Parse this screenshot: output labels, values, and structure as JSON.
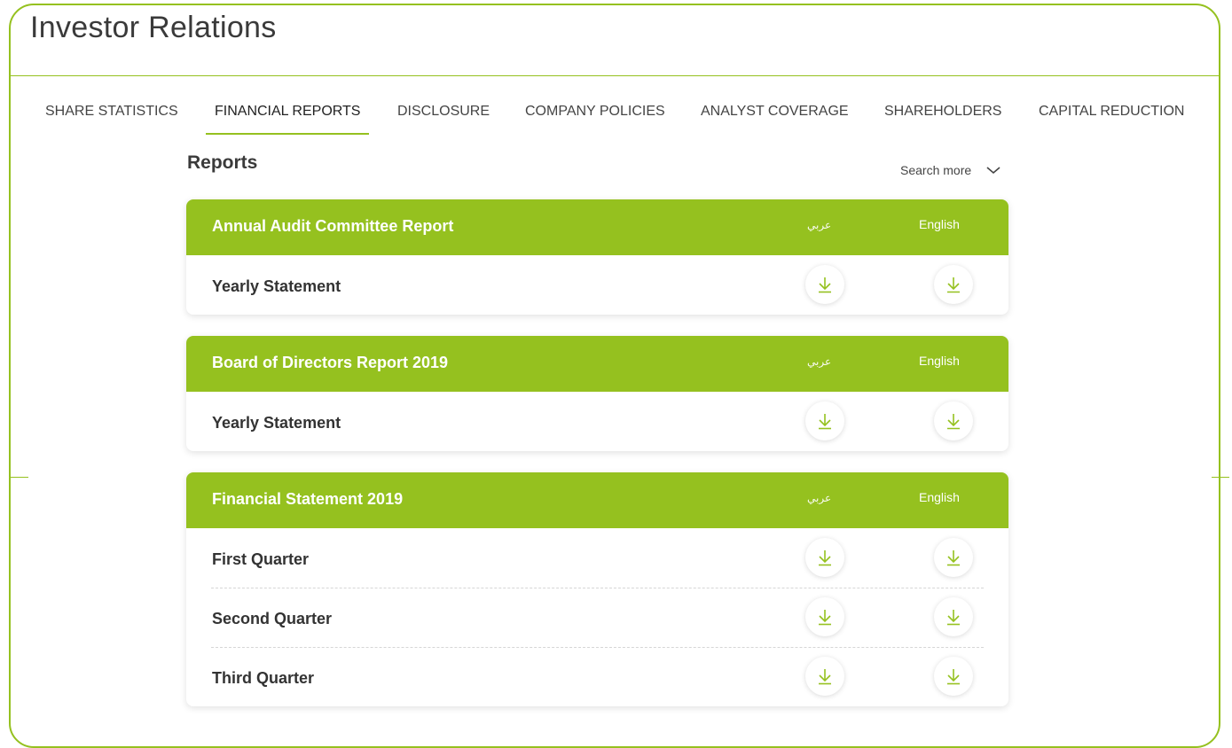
{
  "page": {
    "title": "Investor Relations"
  },
  "tabs": [
    {
      "label": "SHARE STATISTICS"
    },
    {
      "label": "FINANCIAL REPORTS"
    },
    {
      "label": "DISCLOSURE"
    },
    {
      "label": "COMPANY POLICIES"
    },
    {
      "label": "ANALYST COVERAGE"
    },
    {
      "label": "SHAREHOLDERS"
    },
    {
      "label": "CAPITAL REDUCTION"
    }
  ],
  "active_tab": "FINANCIAL REPORTS",
  "reports": {
    "heading": "Reports",
    "search_more": "Search more"
  },
  "cards": [
    {
      "title": "Annual Audit Committee Report",
      "lang_ar": "عربي",
      "lang_en": "English",
      "rows": [
        {
          "label": "Yearly Statement"
        }
      ]
    },
    {
      "title": "Board of Directors Report 2019",
      "lang_ar": "عربي",
      "lang_en": "English",
      "rows": [
        {
          "label": "Yearly Statement"
        }
      ]
    },
    {
      "title": "Financial Statement 2019",
      "lang_ar": "عربي",
      "lang_en": "English",
      "rows": [
        {
          "label": "First Quarter"
        },
        {
          "label": "Second Quarter"
        },
        {
          "label": "Third Quarter"
        }
      ]
    }
  ],
  "colors": {
    "accent": "#95c11f",
    "text_dark": "#333333"
  },
  "icons": {
    "download": "download-icon",
    "chevron": "chevron-down-icon"
  }
}
